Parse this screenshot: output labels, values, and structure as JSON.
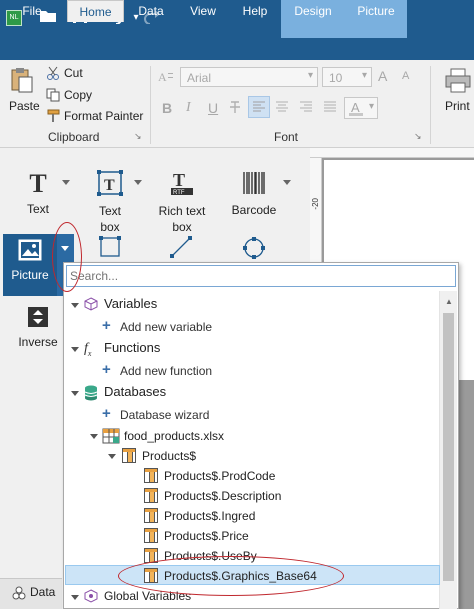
{
  "titlebar": {
    "app_icon": "nicelabel-icon",
    "quick_access": [
      "folder-open-icon",
      "save-icon",
      "undo-icon",
      "redo-icon"
    ]
  },
  "tabs": [
    {
      "label": "File"
    },
    {
      "label": "Home"
    },
    {
      "label": "Data"
    },
    {
      "label": "View"
    },
    {
      "label": "Help"
    },
    {
      "label": "Design"
    },
    {
      "label": "Picture"
    }
  ],
  "ribbon": {
    "clipboard": {
      "paste": "Paste",
      "cut": "Cut",
      "copy": "Copy",
      "format_painter": "Format Painter",
      "group_label": "Clipboard"
    },
    "font": {
      "font_name": "Arial",
      "font_size": "10",
      "bold": "B",
      "italic": "I",
      "underline": "U",
      "grow": "A",
      "shrink": "A",
      "color": "A",
      "group_label": "Font"
    },
    "print": {
      "label": "Print"
    }
  },
  "tools": {
    "text": "Text",
    "textbox": "Text box",
    "richtext": "Rich text box",
    "barcode": "Barcode",
    "picture": "Picture",
    "inverse": "Inverse"
  },
  "ruler": {
    "mark": "-20"
  },
  "statusbar": {
    "label": "Data"
  },
  "dropdown": {
    "search_placeholder": "Search...",
    "variables": "Variables",
    "add_variable": "Add new variable",
    "functions": "Functions",
    "add_function": "Add new function",
    "databases": "Databases",
    "database_wizard": "Database wizard",
    "file": "food_products.xlsx",
    "table": "Products$",
    "fields": [
      "Products$.ProdCode",
      "Products$.Description",
      "Products$.Ingred",
      "Products$.Price",
      "Products$.UseBy",
      "Products$.Graphics_Base64"
    ],
    "global_variables": "Global Variables"
  },
  "colors": {
    "titlebar": "#1f5b8e",
    "context_tab": "#7ab0de",
    "selection": "#cce4f7",
    "annotation": "#c0282e"
  }
}
